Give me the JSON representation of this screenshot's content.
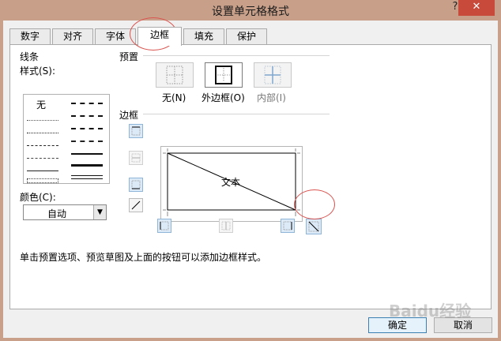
{
  "window": {
    "title": "设置单元格格式",
    "help": "?",
    "close": "✕"
  },
  "tabs": [
    {
      "label": "数字"
    },
    {
      "label": "对齐"
    },
    {
      "label": "字体"
    },
    {
      "label": "边框"
    },
    {
      "label": "填充"
    },
    {
      "label": "保护"
    }
  ],
  "active_tab": "边框",
  "line": {
    "group_label": "线条",
    "style_label": "样式(S):",
    "none_label": "无",
    "color_label": "颜色(C):",
    "color_value": "自动"
  },
  "presets": {
    "group_label": "预置",
    "none": "无(N)",
    "outline": "外边框(O)",
    "inside": "内部(I)"
  },
  "border": {
    "group_label": "边框",
    "preview_text": "文本"
  },
  "hint": "单击预置选项、预览草图及上面的按钮可以添加边框样式。",
  "buttons": {
    "ok": "确定",
    "cancel": "取消"
  },
  "colors": {
    "titlebar": "#c8a08a",
    "close": "#c74a3b",
    "accent_button": "#dce9f7",
    "annotation": "#d9534f"
  },
  "watermark": "Baidu经验"
}
